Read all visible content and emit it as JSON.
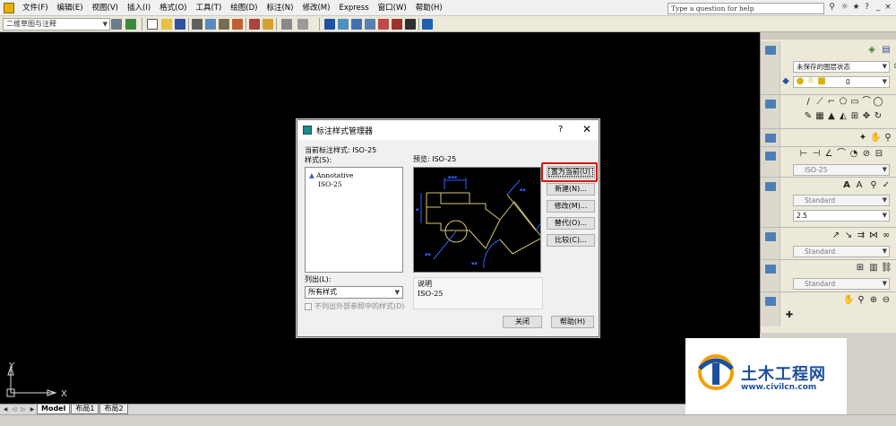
{
  "menubar": {
    "items": [
      "文件(F)",
      "编辑(E)",
      "视图(V)",
      "插入(I)",
      "格式(O)",
      "工具(T)",
      "绘图(D)",
      "标注(N)",
      "修改(M)",
      "Express",
      "窗口(W)",
      "帮助(H)"
    ],
    "help_search_placeholder": "Type a question for help"
  },
  "toolbar": {
    "workspace": "二维草图与注释"
  },
  "tabs": [
    "Model",
    "布局1",
    "布局2"
  ],
  "palette": {
    "layer_state": "未保存的图层状态",
    "layer_current": "0",
    "dim_style": "ISO-25",
    "text_style": "Standard",
    "text_height": "2.5",
    "multileader_style": "Standard",
    "table_style": "Standard"
  },
  "dialog": {
    "title": "标注样式管理器",
    "help_glyph": "?",
    "close_glyph": "✕",
    "current_style_label": "当前标注样式: ISO-25",
    "styles_label": "样式(S):",
    "styles": [
      "Annotative",
      "ISO-25"
    ],
    "list_label": "列出(L):",
    "list_value": "所有样式",
    "xref_checkbox_label": "不列出外部参照中的样式(D)",
    "preview_label": "预览: ISO-25",
    "description_label": "说明",
    "description_value": "ISO-25",
    "buttons": {
      "set_current": "置为当前(U)",
      "new": "新建(N)...",
      "modify": "修改(M)...",
      "override": "替代(O)...",
      "compare": "比较(C)...",
      "close": "关闭",
      "help": "帮助(H)"
    }
  },
  "ucs": {
    "x_label": "X",
    "y_label": "Y"
  },
  "watermark": {
    "title": "土木工程网",
    "url": "www.civilcn.com"
  },
  "colors": {
    "canvas": "#000000",
    "dialog_bg": "#f0f0f0",
    "highlight": "#e01010",
    "preview_lines": "#d8c870",
    "preview_dims": "#3060ff",
    "watermark_blue": "#1d4f9c"
  }
}
